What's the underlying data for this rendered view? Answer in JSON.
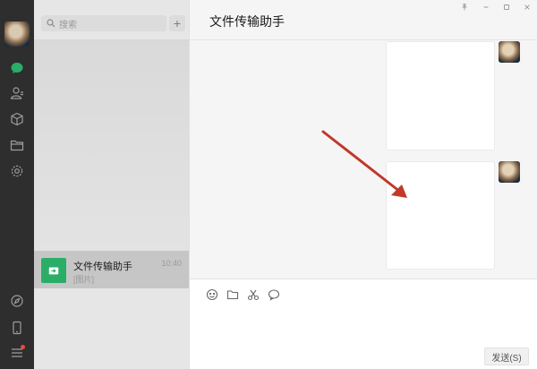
{
  "sidebar": {
    "icons": [
      "chat-icon",
      "contacts-icon",
      "favorites-box-icon",
      "folder-icon",
      "settings-gear-icon",
      "compass-icon",
      "phone-icon",
      "menu-icon"
    ],
    "accent_color": "#2aae67",
    "notification_color": "#e94a3b"
  },
  "search": {
    "placeholder": "搜索"
  },
  "add_button_label": "+",
  "chat_list": [
    {
      "name": "文件传输助手",
      "time": "10:40",
      "preview": "[图片]"
    }
  ],
  "chat": {
    "title": "文件传输助手"
  },
  "window_controls": [
    "pin-icon",
    "minimize-icon",
    "maximize-icon",
    "close-icon"
  ],
  "composer": {
    "tools": [
      "emoji-icon",
      "folder-icon",
      "scissors-icon",
      "bubble-icon"
    ],
    "send_label": "发送(S)"
  }
}
